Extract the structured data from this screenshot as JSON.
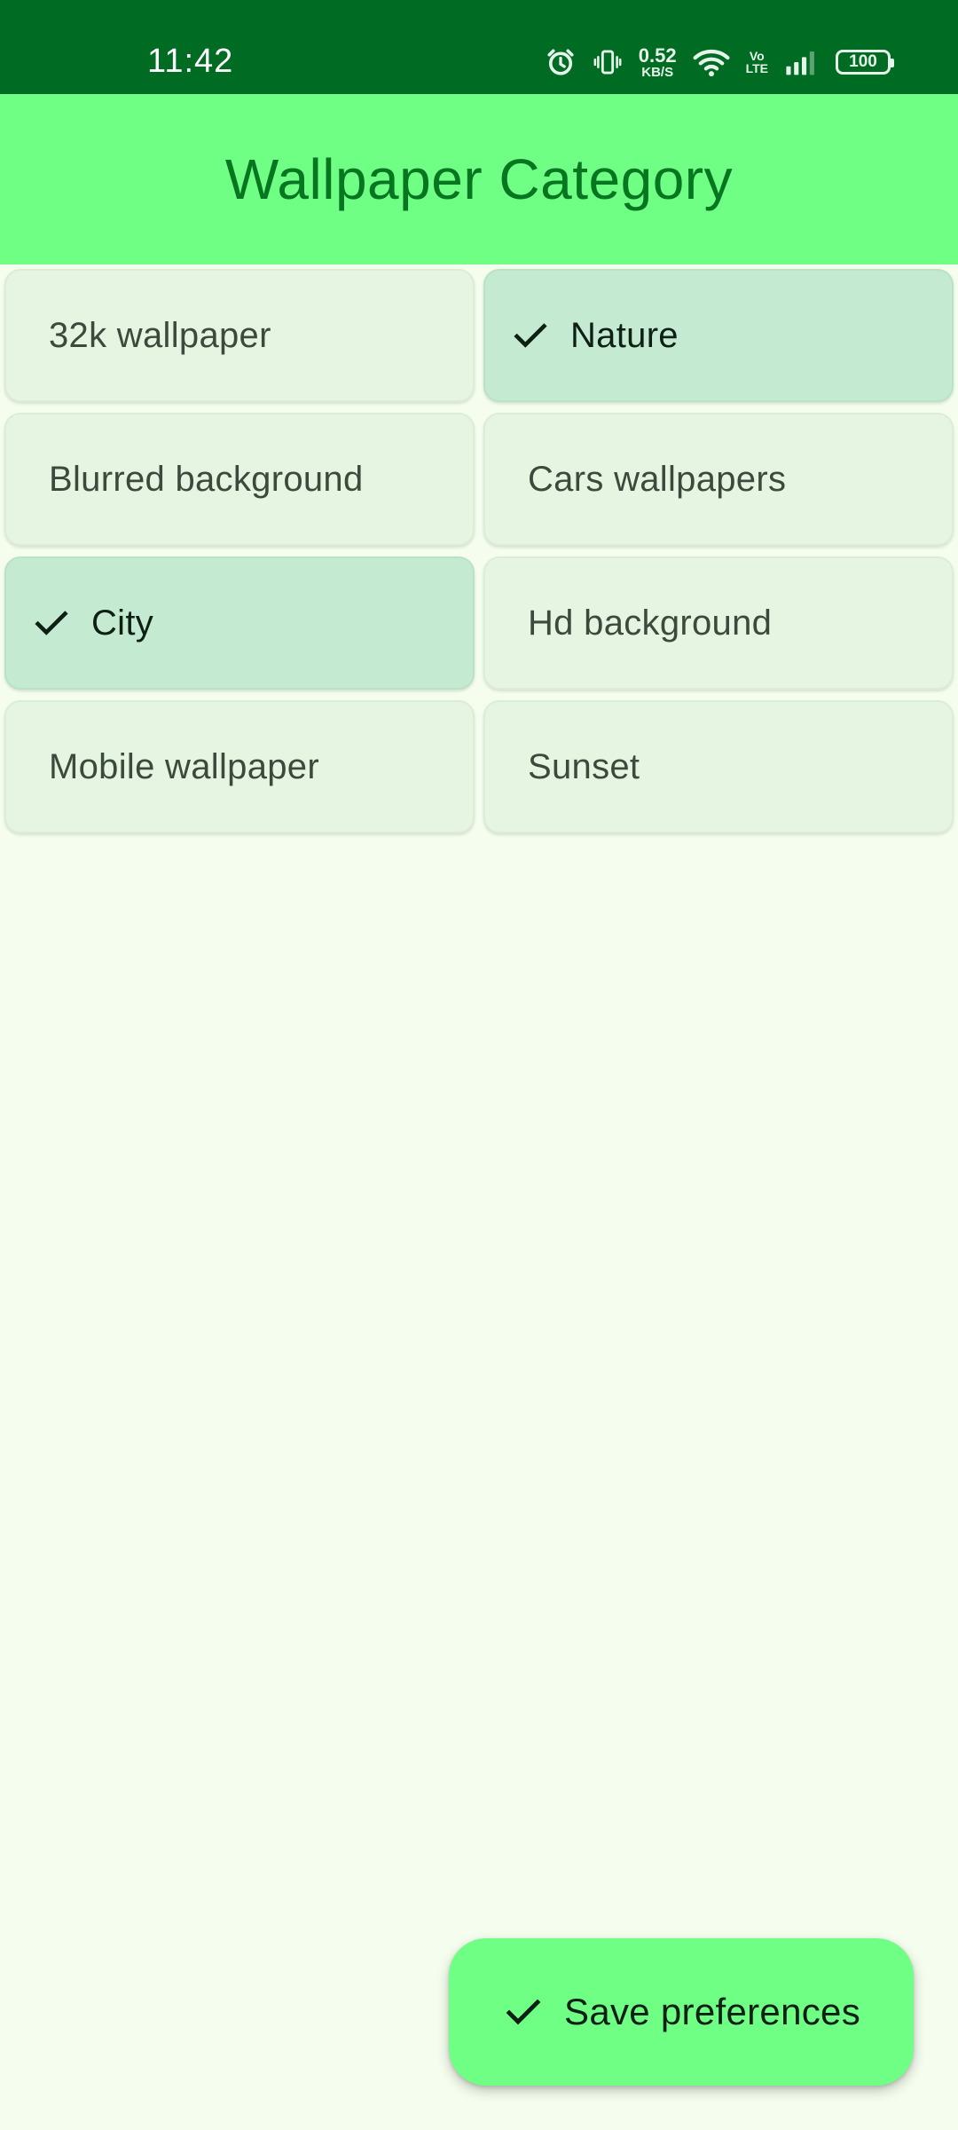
{
  "status_bar": {
    "time": "11:42",
    "net_speed_value": "0.52",
    "net_speed_unit": "KB/S",
    "volte_top": "Vo",
    "volte_bottom": "LTE",
    "battery": "100"
  },
  "app_bar": {
    "title": "Wallpaper Category"
  },
  "categories": [
    {
      "label": "32k wallpaper",
      "selected": false
    },
    {
      "label": "Nature",
      "selected": true
    },
    {
      "label": "Blurred background",
      "selected": false
    },
    {
      "label": "Cars wallpapers",
      "selected": false
    },
    {
      "label": "City",
      "selected": true
    },
    {
      "label": "Hd background",
      "selected": false
    },
    {
      "label": "Mobile wallpaper",
      "selected": false
    },
    {
      "label": "Sunset",
      "selected": false
    }
  ],
  "fab": {
    "label": "Save preferences",
    "icon": "check-icon"
  },
  "colors": {
    "status_bar": "#006B23",
    "app_bar": "#6EFF84",
    "title": "#087520",
    "background": "#F4FDEE",
    "chip": "#E6F5E2",
    "chip_selected": "#C4EBD1"
  }
}
